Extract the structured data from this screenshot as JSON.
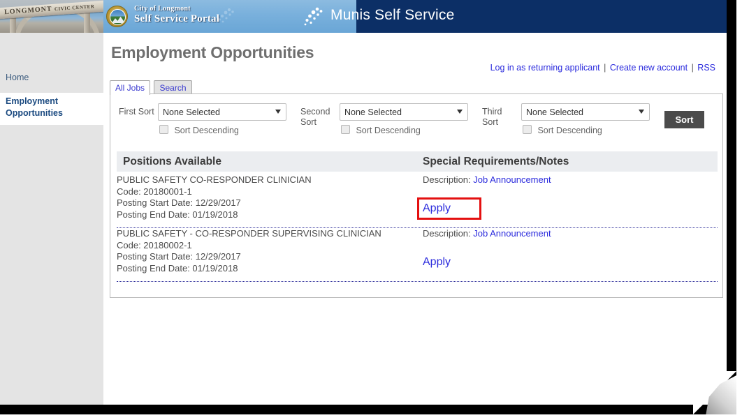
{
  "banner": {
    "photo_text_main": "LONGMONT",
    "photo_text_sub": "CIVIC CENTER",
    "portal_line1": "City of Longmont",
    "portal_line2": "Self Service Portal",
    "product_title": "Munis Self Service",
    "seal_icon": "city-seal-icon",
    "munis_icon": "munis-logo-icon",
    "watermark_icon": "munis-watermark-icon",
    "background_color": "#0c2f66",
    "band_color": "#79b0dc"
  },
  "sidebar": {
    "items": [
      {
        "label": "Home",
        "active": false
      },
      {
        "label": "Employment Opportunities",
        "active": true
      }
    ]
  },
  "main": {
    "page_title": "Employment Opportunities",
    "top_links": [
      {
        "label": "Log in as returning applicant"
      },
      {
        "label": "Create new account"
      },
      {
        "label": "RSS"
      }
    ],
    "link_separator": "|",
    "tabs": [
      {
        "label": "All Jobs",
        "active": true
      },
      {
        "label": "Search",
        "active": false
      }
    ],
    "sort": {
      "groups": [
        {
          "label": "First Sort",
          "value": "None Selected",
          "descending_label": "Sort Descending",
          "checked": false
        },
        {
          "label": "Second Sort",
          "value": "None Selected",
          "descending_label": "Sort Descending",
          "checked": false
        },
        {
          "label": "Third Sort",
          "value": "None Selected",
          "descending_label": "Sort Descending",
          "checked": false
        }
      ],
      "button_label": "Sort",
      "button_color": "#4b4b4b"
    },
    "table": {
      "headers": [
        "Positions Available",
        "Special Requirements/Notes"
      ],
      "rows": [
        {
          "title": "PUBLIC SAFETY CO-RESPONDER CLINICIAN",
          "code": "Code: 20180001-1",
          "start": "Posting Start Date: 12/29/2017",
          "end": "Posting End Date: 01/19/2018",
          "description_label": "Description:",
          "description_link": "Job Announcement",
          "apply_label": "Apply",
          "highlighted": true
        },
        {
          "title": "PUBLIC SAFETY - CO-RESPONDER SUPERVISING CLINICIAN",
          "code": "Code: 20180002-1",
          "start": "Posting Start Date: 12/29/2017",
          "end": "Posting End Date: 01/19/2018",
          "description_label": "Description:",
          "description_link": "Job Announcement",
          "apply_label": "Apply",
          "highlighted": false
        }
      ]
    },
    "annotation": {
      "highlight_color": "#e41010",
      "target": "apply-link-row-1"
    }
  }
}
